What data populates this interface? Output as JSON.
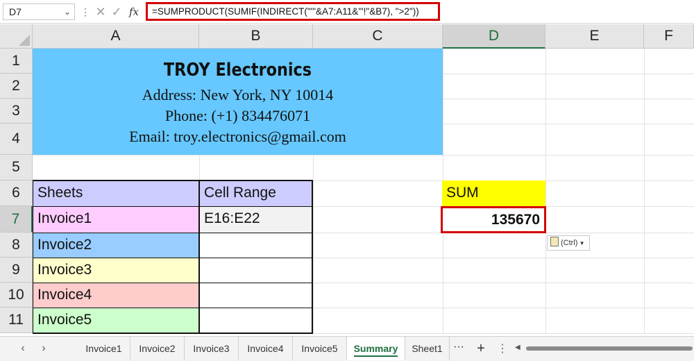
{
  "formula_bar": {
    "name_box": "D7",
    "separator_icon": "vertical-dots-icon",
    "cancel_icon": "close-icon",
    "enter_icon": "check-icon",
    "fx_label": "fx",
    "formula": "=SUMPRODUCT(SUMIF(INDIRECT(\"'\"&A7:A11&\"'!\"&B7), \">2\"))"
  },
  "columns": [
    "A",
    "B",
    "C",
    "D",
    "E",
    "F"
  ],
  "selected_column": "D",
  "rows": [
    "1",
    "2",
    "3",
    "4",
    "5",
    "6",
    "7",
    "8",
    "9",
    "10",
    "11"
  ],
  "selected_row": "7",
  "company": {
    "name": "TROY Electronics",
    "address": "Address: New York, NY 10014",
    "phone": "Phone: (+1) 834476071",
    "email": "Email: troy.electronics@gmail.com",
    "fill_color": "#66c8ff"
  },
  "table": {
    "headers": [
      "Sheets",
      "Cell Range"
    ],
    "header_color": "#ccccff",
    "rows": [
      {
        "sheet": "Invoice1",
        "range": "E16:E22",
        "color": "#ffccff"
      },
      {
        "sheet": "Invoice2",
        "range": "",
        "color": "#99ccff"
      },
      {
        "sheet": "Invoice3",
        "range": "",
        "color": "#ffffcc"
      },
      {
        "sheet": "Invoice4",
        "range": "",
        "color": "#ffcccc"
      },
      {
        "sheet": "Invoice5",
        "range": "",
        "color": "#ccffcc"
      }
    ]
  },
  "sum": {
    "label": "SUM",
    "value": "135670",
    "paste_options": "(Ctrl)"
  },
  "sheet_tabs": {
    "prev_icon": "chevron-left-icon",
    "next_icon": "chevron-right-icon",
    "tabs": [
      "Invoice1",
      "Invoice2",
      "Invoice3",
      "Invoice4",
      "Invoice5",
      "Summary",
      "Sheet1"
    ],
    "active": "Summary",
    "more_label": "···",
    "add_label": "+"
  },
  "colors": {
    "accent_green": "#1e7145",
    "highlight_red": "#d40000",
    "sum_fill": "#ffff00"
  }
}
